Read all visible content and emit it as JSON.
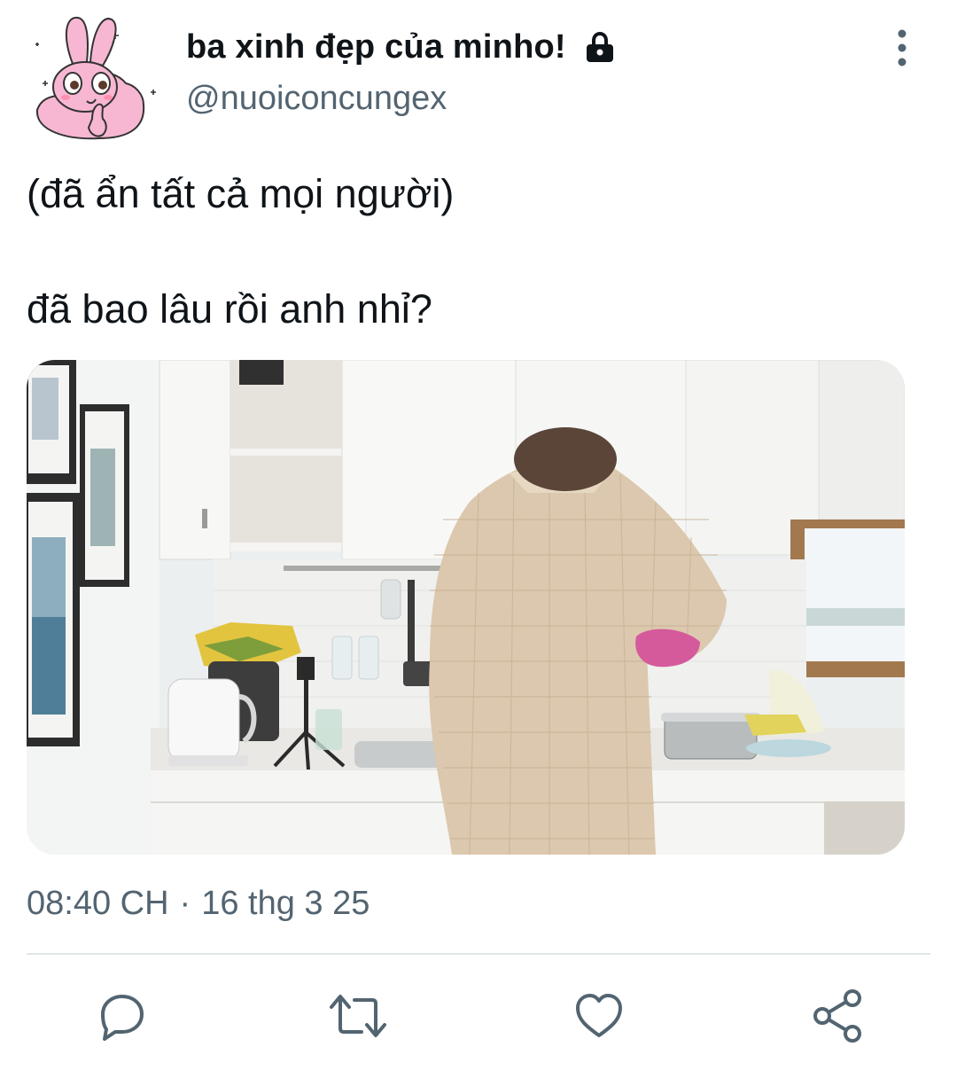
{
  "author": {
    "display_name": "ba xinh đẹp của minho!",
    "handle": "@nuoiconcungex",
    "avatar_icon": "pink-bunny-avatar-icon",
    "protected_icon": "lock-icon"
  },
  "tweet": {
    "lines": [
      "(đã ẩn tất cả mọi người)",
      "đã bao lâu rồi anh nhỉ?"
    ],
    "media_alt": "photo-kitchen",
    "time": "08:40 CH",
    "separator": "·",
    "date": "16 thg 3 25"
  },
  "actions": [
    {
      "name": "reply",
      "icon": "comment-icon"
    },
    {
      "name": "retweet",
      "icon": "retweet-icon"
    },
    {
      "name": "like",
      "icon": "heart-icon"
    },
    {
      "name": "share",
      "icon": "share-icon"
    }
  ],
  "colors": {
    "text": "#0f1419",
    "secondary": "#536471",
    "divider": "#e3e6e8",
    "avatar_pink": "#f7b7d3"
  }
}
